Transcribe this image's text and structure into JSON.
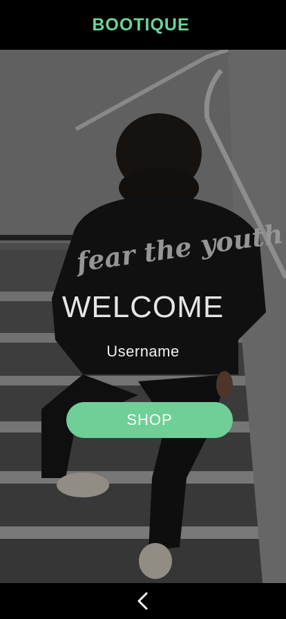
{
  "header": {
    "brand": "BOOTIQUE",
    "brand_color": "#6fd39a"
  },
  "hero": {
    "photo_description_icon": "person-in-jacket-on-stairs-photo",
    "jacket_print": "fear the youth",
    "welcome": "WELCOME",
    "username": "Username",
    "shop_label": "SHOP",
    "button_color": "#6fcf97"
  },
  "nav": {
    "back_icon": "chevron-left-icon"
  }
}
